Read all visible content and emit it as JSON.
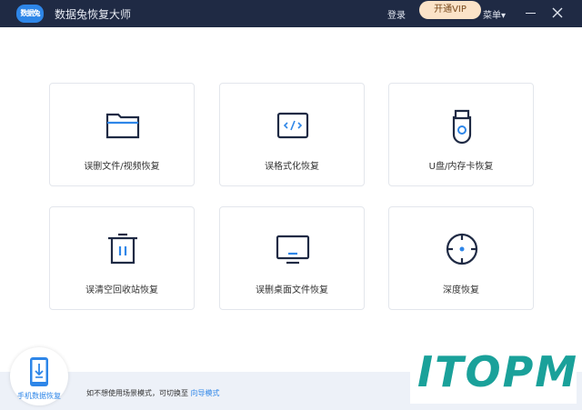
{
  "titlebar": {
    "logo_text": "数据兔",
    "app_title": "数据兔恢复大师",
    "login_label": "登录",
    "vip_label": "开通VIP",
    "menu_label": "菜单▾"
  },
  "cards": [
    {
      "label": "误删文件/视频恢复",
      "icon": "folder-icon"
    },
    {
      "label": "误格式化恢复",
      "icon": "code-window-icon"
    },
    {
      "label": "U盘/内存卡恢复",
      "icon": "usb-drive-icon"
    },
    {
      "label": "误清空回收站恢复",
      "icon": "trash-icon"
    },
    {
      "label": "误删桌面文件恢复",
      "icon": "monitor-icon"
    },
    {
      "label": "深度恢复",
      "icon": "target-icon"
    }
  ],
  "bottom": {
    "phone_label": "手机数据恢复",
    "hint_text": "如不想使用场景模式，可切换至",
    "hint_link": "向导模式"
  },
  "watermark": {
    "text": "ITOPM"
  },
  "colors": {
    "titlebar": "#1f2a44",
    "accent": "#2e86e8",
    "vip_bg": "#fbe3c8",
    "watermark": "#1aa19a"
  }
}
